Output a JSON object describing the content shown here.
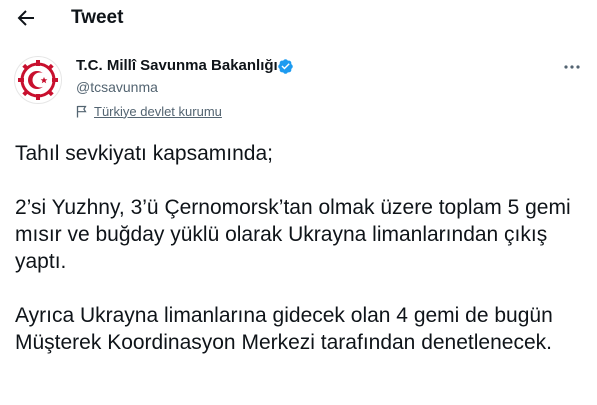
{
  "header": {
    "title": "Tweet",
    "back_icon": "arrow-left-icon"
  },
  "author": {
    "display_name": "T.C. Millî Savunma Bakanlığı",
    "handle": "@tcsavunma",
    "verified": true,
    "verified_color": "#1d9bf0",
    "label": "Türkiye devlet kurumu",
    "label_icon": "flag-icon"
  },
  "more_icon": "more-horizontal-icon",
  "tweet": {
    "paragraphs": [
      "Tahıl sevkiyatı kapsamında;",
      "2’si Yuzhny, 3’ü Çernomorsk’tan olmak üzere toplam 5 gemi mısır ve buğday yüklü olarak Ukrayna limanlarından çıkış yaptı.",
      "Ayrıca Ukrayna limanlarına gidecek olan 4 gemi de bugün Müşterek Koordinasyon Merkezi tarafından denetlenecek."
    ]
  },
  "colors": {
    "text": "#0f1419",
    "secondary": "#536471",
    "accent": "#1d9bf0",
    "logo_red": "#c8102e"
  }
}
